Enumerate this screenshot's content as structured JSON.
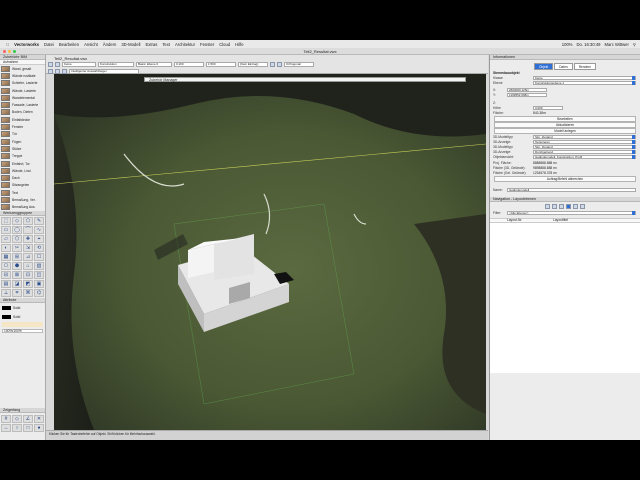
{
  "menubar": {
    "app_name": "Vectorworks",
    "items": [
      "Datei",
      "Bearbeiten",
      "Ansicht",
      "Ändern",
      "3D-Modell",
      "Extras",
      "Text",
      "Architektur",
      "Fenster",
      "Cloud",
      "Hilfe"
    ],
    "clock": "Do. 16:30:49",
    "user": "Marc Wittwer",
    "battery": "100%"
  },
  "window": {
    "title": "Teil2_Resultat.vwx",
    "tab_title": "Teil2_Resultat.vwx"
  },
  "left_palette": {
    "resource_title": "Zubehörbr BIM",
    "search_tab": "Aufnahme",
    "resources": [
      "Wand, gesalt",
      "Wände rustikale",
      "Schiefer, Lasierte",
      "Wände, Lasierte",
      "Wandelemental",
      "Fassade, Lasierte",
      "Boden, Dielen",
      "Einfaltdecke",
      "Fenster",
      "Tür",
      "Fügen",
      "Stütze",
      "Treppe",
      "Einfahrt, Tor",
      "Wände, Lind.",
      "Dach",
      "Sitzangelen",
      "Text",
      "Bemaßung, Ver.",
      "Bemaßung Aus."
    ],
    "tools_title": "Werkzeuggruppen",
    "attr_title": "Attribute",
    "fill_label": "Solid",
    "pen_label": "Solid",
    "opacity_label": "100%/100%",
    "snap_title": "Zeigerfang"
  },
  "toolbar": {
    "view_label": "Keine",
    "class_label": "Konstruktion",
    "layer_label": "Basis: Ebene 0",
    "render_label": "0.100",
    "scale_label": "1:500",
    "zoom_label": "(Kein Eintrag)",
    "mode_label": "Orthogonal",
    "constraint_label": "Intelligenter Auswahlzeiger"
  },
  "viewport": {
    "hint_text": "Zubehör Manager",
    "overlay_tab": "Objekt"
  },
  "statusbar": {
    "text": "Klicken Sie für Tastenbefehle auf Objekt. Shift klicken für Mehrfachauswahl."
  },
  "info_palette": {
    "title": "Informationen",
    "tabs": [
      "Objekt",
      "Daten",
      "Rendern"
    ],
    "object_type": "Stemmbauobjekt",
    "class_label": "Klasse",
    "class_value": "Keine",
    "layer_label": "Ebene",
    "layer_value": "Konstruktionsebene 1",
    "x_label": "X:",
    "x_value": "2600000.125m",
    "y_label": "Y:",
    "y_value": "1199552.068m",
    "z_label": "Z:",
    "height_label": "Höhe",
    "height_value": "3.000",
    "area_label": "Fläche:",
    "area_value": "843.38m",
    "buttons": [
      "Bearbeiten",
      "Aktualisieren",
      "Modell anlegen"
    ],
    "fields": [
      {
        "label": "3D-Modelltyp:",
        "value": "Sim. Zustand"
      },
      {
        "label": "3D-Anzeige:",
        "value": "Texturieren"
      },
      {
        "label": "3D-Modelltyp:",
        "value": "Sim. Zustand"
      },
      {
        "label": "3D-Anzeige:",
        "value": "Durchgehend"
      },
      {
        "label": "Objektansicht:",
        "value": "Geländemodell, Konstruktion, Profil"
      }
    ],
    "proj_area_label": "Proj. Fläche:",
    "proj_area_value": "8888888.888 m²",
    "surface_area_label": "Fläche (3D, Gelände):",
    "surface_area_value": "9898888.888 m²",
    "surface_total_label": "Fläche (Gel. Gelände):",
    "surface_total_value": "1234578.378 m²",
    "action_button": "Auftrag/Befehl abbrechen",
    "name_label": "Name:",
    "name_value": "Geländemodell"
  },
  "navigation_palette": {
    "title": "Navigation - Layoutebenen",
    "filter_label": "Filter:",
    "filter_value": "<Alle Ebenen>",
    "col_name": "Layout-Nr.",
    "col_title": "Layouttitel"
  },
  "colors": {
    "accent": "#2f6fd6",
    "window_bg": "#d9d9d9",
    "palette_bg": "#ececec",
    "building": "#f2f2f2"
  }
}
